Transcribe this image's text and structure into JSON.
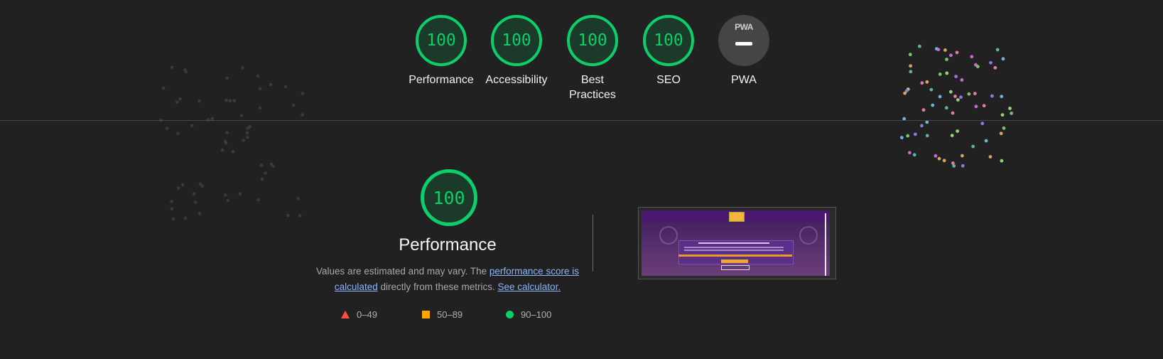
{
  "categories": [
    {
      "label": "Performance",
      "score": "100"
    },
    {
      "label": "Accessibility",
      "score": "100"
    },
    {
      "label": "Best Practices",
      "score": "100"
    },
    {
      "label": "SEO",
      "score": "100"
    },
    {
      "label": "PWA",
      "badge": "PWA",
      "score": "—"
    }
  ],
  "main": {
    "score": "100",
    "title": "Performance",
    "desc_prefix": "Values are estimated and may vary. The ",
    "desc_link1": "performance score is calculated",
    "desc_middle": " directly from these metrics. ",
    "desc_link2": "See calculator."
  },
  "legend": [
    {
      "icon": "fail-triangle-icon",
      "range": "0–49",
      "color": "#ff4e42"
    },
    {
      "icon": "average-square-icon",
      "range": "50–89",
      "color": "#ffa400"
    },
    {
      "icon": "pass-circle-icon",
      "range": "90–100",
      "color": "#0cce6b"
    }
  ],
  "colors": {
    "pass": "#0cce6b",
    "background": "#212121"
  }
}
